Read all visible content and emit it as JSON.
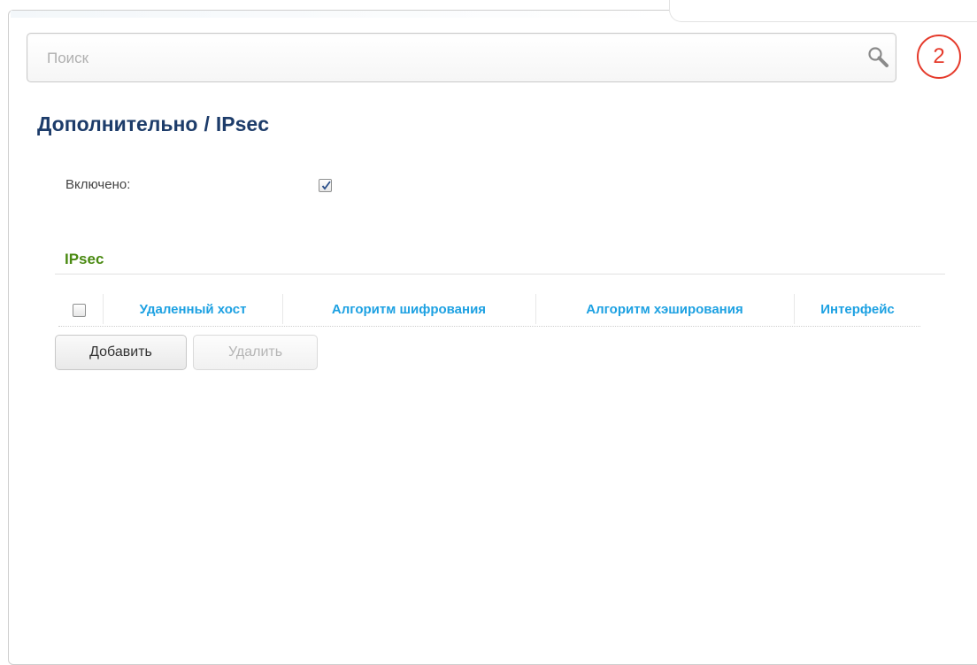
{
  "search": {
    "placeholder": "Поиск"
  },
  "badge": {
    "number": "2",
    "color": "#e53a2b"
  },
  "breadcrumb": {
    "parent": "Дополнительно",
    "separator": "/",
    "current": "IPsec"
  },
  "settings": {
    "enabled_label": "Включено:",
    "enabled_checked": true
  },
  "section": {
    "title": "IPsec"
  },
  "table": {
    "columns": [
      "Удаленный хост",
      "Алгоритм шифрования",
      "Алгоритм хэширования",
      "Интерфейс"
    ],
    "rows": []
  },
  "buttons": {
    "add_label": "Добавить",
    "delete_label": "Удалить"
  },
  "colors": {
    "title": "#1d3c6a",
    "section_title": "#4a8a12",
    "column_header": "#1da1e2"
  },
  "icons": {
    "search": "search-icon",
    "checkmark": "checkmark-icon"
  }
}
